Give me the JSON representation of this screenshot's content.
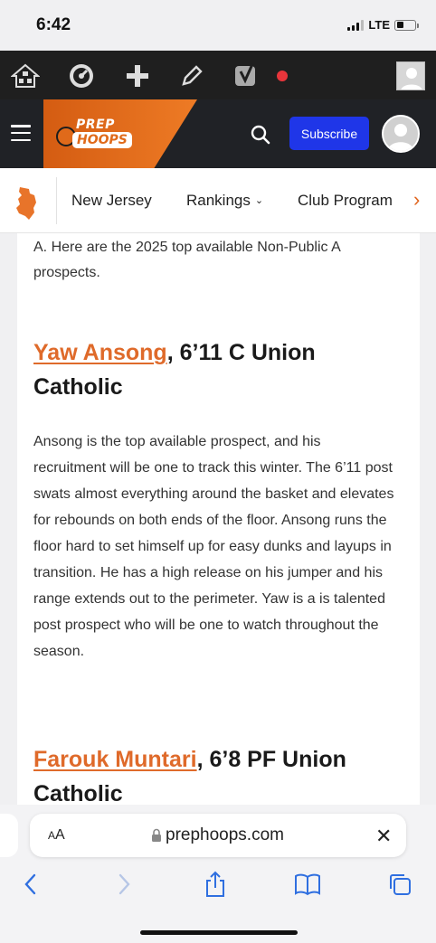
{
  "status_bar": {
    "time": "6:42",
    "network": "LTE"
  },
  "admin_bar": {
    "icons": [
      "network-home-icon",
      "dashboard-icon",
      "plus-icon",
      "pencil-icon",
      "yoast-icon",
      "status-dot-icon"
    ]
  },
  "header": {
    "logo_top": "PREP",
    "logo_bottom": "HOOPS",
    "subscribe_label": "Subscribe",
    "accent": "#e06a1a",
    "subscribe_color": "#1f36e8"
  },
  "nav": {
    "items": [
      {
        "label": "New Jersey"
      },
      {
        "label": "Rankings",
        "caret": "⌄"
      },
      {
        "label": "Club Program"
      }
    ]
  },
  "article": {
    "intro": "A. Here are the 2025 top available Non-Public A prospects.",
    "prospects": [
      {
        "name": "Yaw Ansong",
        "details": ", 6’11 C Union Catholic",
        "paragraph": "Ansong is the top available prospect, and his recruitment will be one to track this winter. The 6’11 post swats almost everything around the basket and elevates for rebounds on both ends of the floor. Ansong runs the floor hard to set himself up for easy dunks and layups in transition. He has a high release on his jumper and his range extends out to the perimeter. Yaw is a is talented post prospect who will be one to watch throughout the season."
      },
      {
        "name": "Farouk Muntari",
        "details": ", 6’8 PF Union Catholic"
      }
    ]
  },
  "browser": {
    "aa_small": "A",
    "aa_large": "A",
    "url": "prephoops.com",
    "close": "✕"
  }
}
